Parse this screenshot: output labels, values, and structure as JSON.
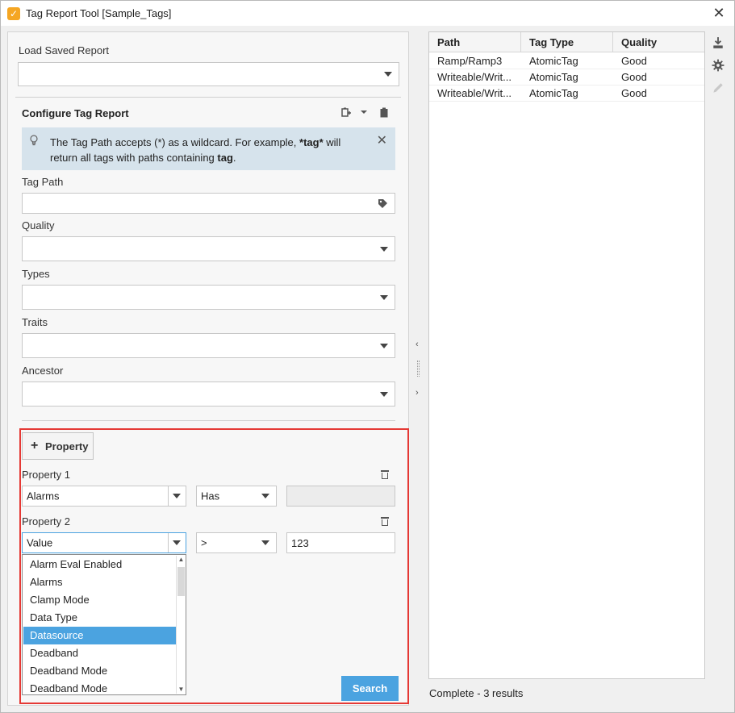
{
  "window": {
    "title": "Tag Report Tool [Sample_Tags]"
  },
  "load_saved": {
    "label": "Load Saved Report",
    "value": ""
  },
  "configure": {
    "title": "Configure Tag Report"
  },
  "info": {
    "text_1": "The Tag Path accepts (*) as a wildcard. For example, ",
    "bold_1": "*tag*",
    "text_2": " will return all tags with paths containing ",
    "bold_2": "tag",
    "text_3": "."
  },
  "fields": {
    "tag_path": {
      "label": "Tag Path",
      "value": ""
    },
    "quality": {
      "label": "Quality",
      "value": ""
    },
    "types": {
      "label": "Types",
      "value": ""
    },
    "traits": {
      "label": "Traits",
      "value": ""
    },
    "ancestor": {
      "label": "Ancestor",
      "value": ""
    }
  },
  "property_button": {
    "label": "Property"
  },
  "properties": [
    {
      "label": "Property 1",
      "name": "Alarms",
      "operator": "Has",
      "value": ""
    },
    {
      "label": "Property 2",
      "name": "Value",
      "operator": ">",
      "value": "123"
    }
  ],
  "dropdown": {
    "items": [
      "Alarm Eval Enabled",
      "Alarms",
      "Clamp Mode",
      "Data Type",
      "Datasource",
      "Deadband",
      "Deadband Mode",
      "Deadband Mode"
    ],
    "selected_index": 4
  },
  "search_button": {
    "label": "Search"
  },
  "results": {
    "columns": [
      "Path",
      "Tag Type",
      "Quality"
    ],
    "rows": [
      [
        "Ramp/Ramp3",
        "AtomicTag",
        "Good"
      ],
      [
        "Writeable/Writ...",
        "AtomicTag",
        "Good"
      ],
      [
        "Writeable/Writ...",
        "AtomicTag",
        "Good"
      ]
    ]
  },
  "status": {
    "text": "Complete - 3 results"
  },
  "icons": {
    "app": "app-icon",
    "close": "close-icon",
    "lightbulb": "lightbulb-icon",
    "tag": "tag-icon",
    "trash": "trash-icon",
    "export": "export-icon",
    "settings": "gear-icon",
    "edit": "pencil-icon"
  },
  "colors": {
    "accent": "#4ba3e0",
    "highlight_frame": "#e53935",
    "info_bg": "#d6e3ec"
  }
}
